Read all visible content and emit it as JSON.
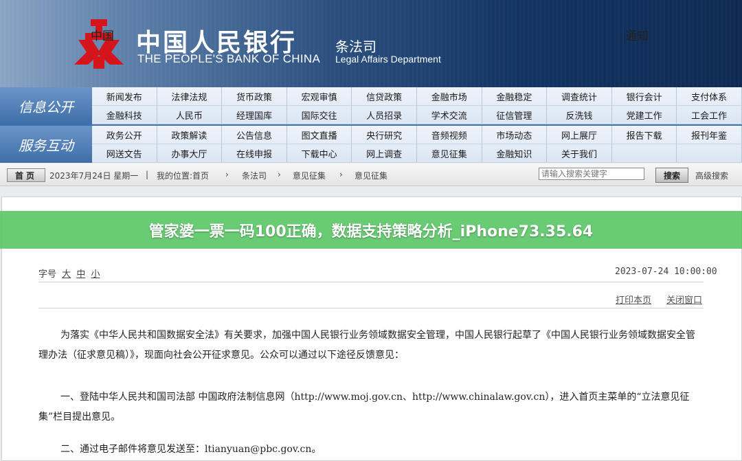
{
  "header": {
    "bank_cn": "中国人民银行",
    "bank_en": "THE PEOPLE'S BANK OF CHINA",
    "dept_cn": "条法司",
    "dept_en": "Legal Affairs Department"
  },
  "nav": [
    {
      "label": "信息公开",
      "items": [
        "新闻发布",
        "法律法规",
        "货币政策",
        "宏观审慎",
        "信贷政策",
        "金融市场",
        "金融稳定",
        "调查统计",
        "银行会计",
        "支付体系",
        "金融科技",
        "人民币",
        "经理国库",
        "国际交往",
        "人员招录",
        "学术交流",
        "征信管理",
        "反洗钱",
        "党建工作",
        "工会工作"
      ]
    },
    {
      "label": "服务互动",
      "items": [
        "政务公开",
        "政策解读",
        "公告信息",
        "图文直播",
        "央行研究",
        "音频视频",
        "市场动态",
        "网上展厅",
        "报告下载",
        "报刊年鉴",
        "网送文告",
        "办事大厅",
        "在线申报",
        "下载中心",
        "网上调查",
        "意见征集",
        "金融知识",
        "关于我们",
        "",
        ""
      ]
    }
  ],
  "toolbar": {
    "home": "首页",
    "date": "2023年7月24日 星期一",
    "location_label": "我的位置:首页",
    "crumb1": "条法司",
    "crumb2": "意见征集",
    "crumb3": "意见征集",
    "search_placeholder": "请输入搜索关键字",
    "search_btn": "搜索",
    "advanced": "高级搜索"
  },
  "banner": {
    "text": "管家婆一票一码100正确，数据支持策略分析_iPhone73.35.64"
  },
  "doc": {
    "title_start": "中国",
    "title_end": "通知",
    "fontsize_label": "字号",
    "size_large": "大",
    "size_medium": "中",
    "size_small": "小",
    "datetime": "2023-07-24 10:00:00",
    "print": "打印本页",
    "close": "关闭窗口",
    "p1": "为落实《中华人民共和国数据安全法》有关要求，加强中国人民银行业务领域数据安全管理，中国人民银行起草了《中国人民银行业务领域数据安全管理办法（征求意见稿）》，现面向社会公开征求意见。公众可以通过以下途径反馈意见：",
    "p2": "一、登陆中华人民共和国司法部 中国政府法制信息网（http://www.moj.gov.cn、http://www.chinalaw.gov.cn），进入首页主菜单的“立法意见征集”栏目提出意见。",
    "p3": "二、通过电子邮件将意见发送至：ltianyuan@pbc.gov.cn。"
  },
  "colors": {
    "header_dark": "#0e2a52",
    "nav_label": "#3f6ea8",
    "banner": "#5cc868"
  }
}
